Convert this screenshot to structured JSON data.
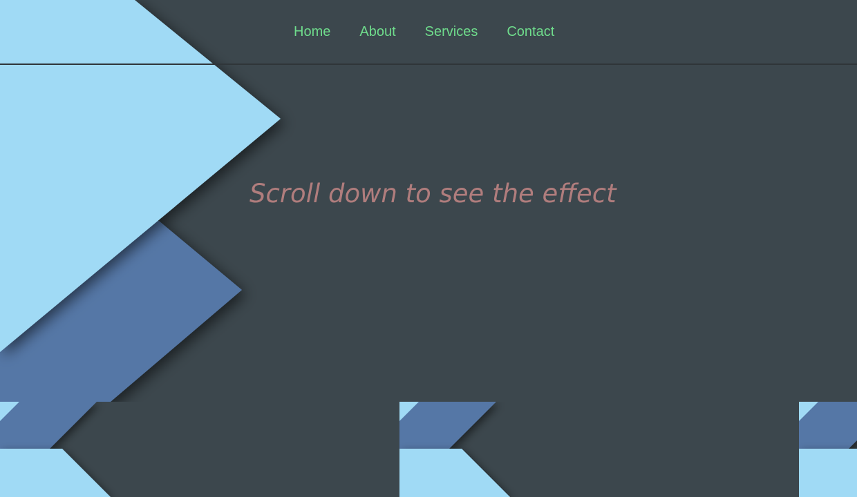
{
  "nav": {
    "items": [
      {
        "label": "Home"
      },
      {
        "label": "About"
      },
      {
        "label": "Services"
      },
      {
        "label": "Contact"
      }
    ],
    "link_color": "#6fdc8c"
  },
  "hero": {
    "text": "Scroll down to see the effect",
    "text_color": "#b07d7d"
  },
  "theme": {
    "background": "#3c474d",
    "light_blue": "#a0daf5",
    "mid_blue": "#5577a6"
  }
}
